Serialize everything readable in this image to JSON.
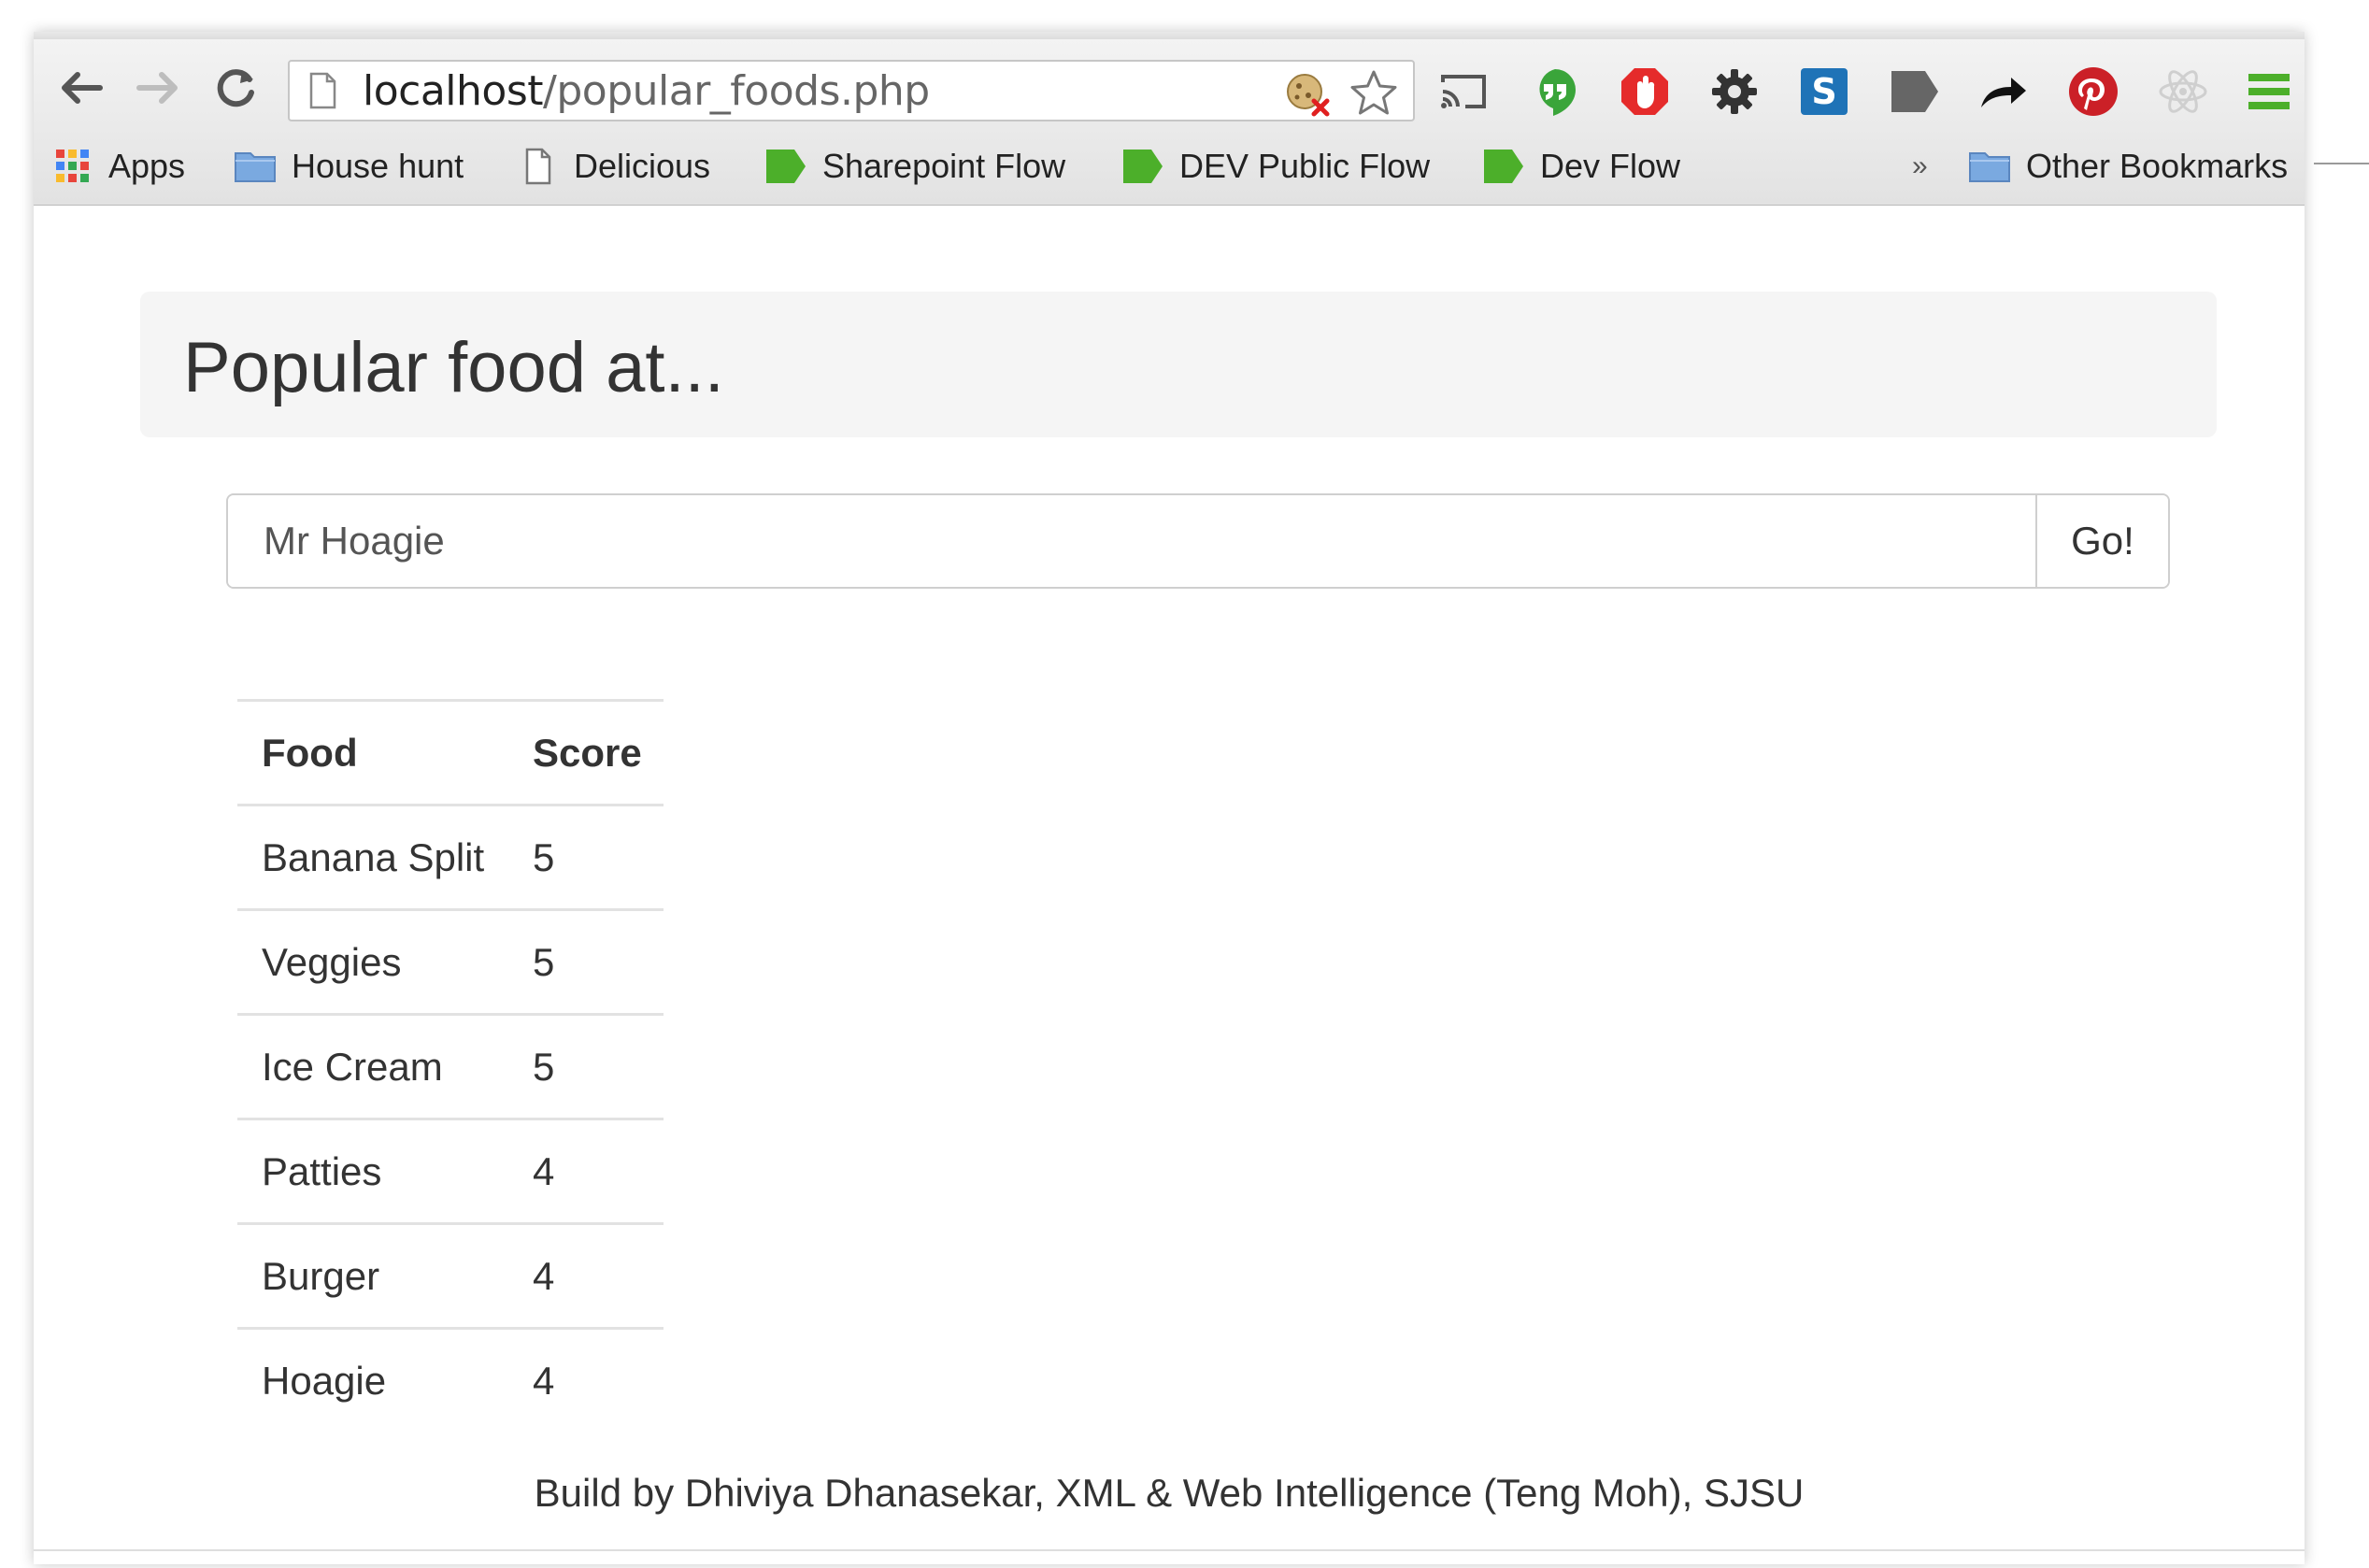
{
  "browser": {
    "url_host": "localhost",
    "url_path": "/popular_foods.php",
    "bookmarks": [
      {
        "label": "Apps",
        "icon": "apps-grid-icon"
      },
      {
        "label": "House hunt",
        "icon": "folder-icon"
      },
      {
        "label": "Delicious",
        "icon": "page-icon"
      },
      {
        "label": "Sharepoint Flow",
        "icon": "green-tag-icon"
      },
      {
        "label": "DEV Public Flow",
        "icon": "green-tag-icon"
      },
      {
        "label": "Dev Flow",
        "icon": "green-tag-icon"
      }
    ],
    "overflow_chevron": "»",
    "other_bookmarks": "Other Bookmarks",
    "colors": {
      "green": "#4caf2a",
      "red": "#e52b2b",
      "blue": "#1f73b7",
      "pinterest": "#cb2027"
    }
  },
  "page": {
    "title": "Popular food at...",
    "search": {
      "value": "Mr Hoagie",
      "button": "Go!"
    },
    "table": {
      "headers": [
        "Food",
        "Score"
      ],
      "rows": [
        {
          "food": "Banana Split",
          "score": "5"
        },
        {
          "food": "Veggies",
          "score": "5"
        },
        {
          "food": "Ice Cream",
          "score": "5"
        },
        {
          "food": "Patties",
          "score": "4"
        },
        {
          "food": "Burger",
          "score": "4"
        },
        {
          "food": "Hoagie",
          "score": "4"
        }
      ]
    },
    "footer": "Build by Dhiviya Dhanasekar, XML & Web Intelligence (Teng Moh), SJSU"
  }
}
